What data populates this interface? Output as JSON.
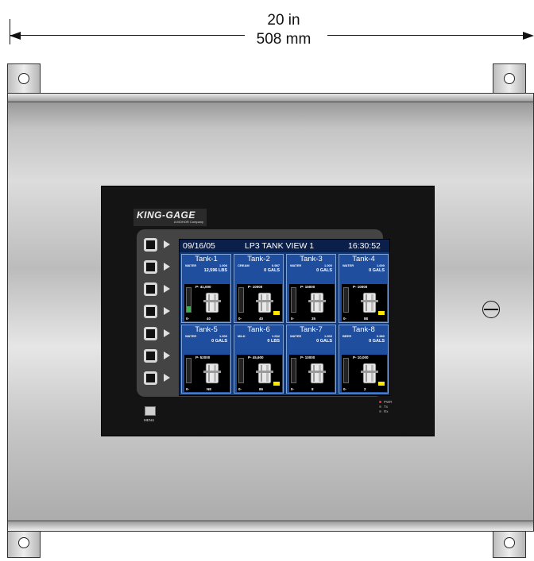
{
  "dimension": {
    "imperial": "20 in",
    "metric": "508 mm"
  },
  "hmi": {
    "brand": "KING-GAGE",
    "brand_sub": "A MOHOR Company",
    "menu_label": "MENU",
    "status": {
      "pwr": "PWR",
      "tx": "Tx",
      "rx": "Rx"
    },
    "screen": {
      "date": "09/16/05",
      "title": "LP3 TANK VIEW 1",
      "time": "16:30:52",
      "tanks": [
        {
          "name": "Tank-1",
          "product": "WATER",
          "sg": "1.000",
          "level": "12,596 LBS",
          "max": "P- 41,000",
          "min": "0-",
          "unit": "40",
          "fill": 0.25
        },
        {
          "name": "Tank-2",
          "product": "CREAM",
          "sg": "0.987",
          "level": "0 GALS",
          "max": "P- 10000",
          "min": "0-",
          "unit": "40",
          "fill": 0
        },
        {
          "name": "Tank-3",
          "product": "WATER",
          "sg": "1.000",
          "level": "0 GALS",
          "max": "P- 15000",
          "min": "0-",
          "unit": "35",
          "fill": 0
        },
        {
          "name": "Tank-4",
          "product": "WATER",
          "sg": "1.000",
          "level": "0 GALS",
          "max": "P- 10000",
          "min": "0-",
          "unit": "88",
          "fill": 0
        },
        {
          "name": "Tank-5",
          "product": "WATER",
          "sg": "1.000",
          "level": "0 GALS",
          "max": "P- 52000",
          "min": "0-",
          "unit": "NE",
          "fill": 0
        },
        {
          "name": "Tank-6",
          "product": "MILK",
          "sg": "1.032",
          "level": "0 LBS",
          "max": "P- 45,600",
          "min": "0-",
          "unit": "86",
          "fill": 0
        },
        {
          "name": "Tank-7",
          "product": "WATER",
          "sg": "1.000",
          "level": "0 GALS",
          "max": "P- 10000",
          "min": "0-",
          "unit": "8",
          "fill": 0
        },
        {
          "name": "Tank-8",
          "product": "BEER",
          "sg": "0.980",
          "level": "0 GALS",
          "max": "P- 10,000",
          "min": "0-",
          "unit": "2",
          "fill": 0
        }
      ]
    }
  },
  "colors": {
    "screen_bg": "#123a78",
    "tile_bg": "#1f4e9e",
    "level_fill": "#39b54a",
    "indicator": "#ffe600",
    "pwr_led": "#ff2a2a"
  },
  "icons": [
    "circle-hole-icon",
    "latch-icon",
    "tank-icon",
    "menu-icon",
    "arrow-right-icon"
  ]
}
